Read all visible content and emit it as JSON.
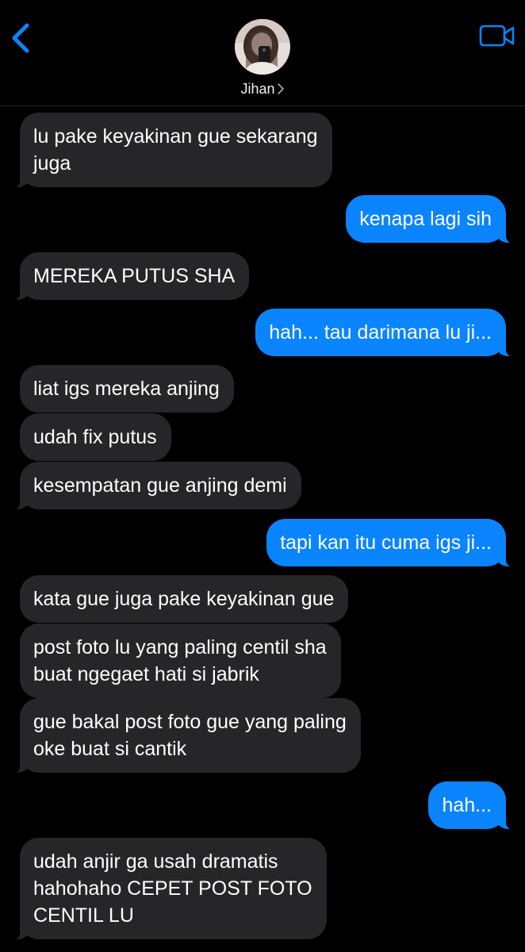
{
  "contact": {
    "name": "Jihan"
  },
  "messages": [
    {
      "dir": "in",
      "lines": [
        "lu pake keyakinan gue sekarang",
        "juga"
      ]
    },
    {
      "dir": "out",
      "lines": [
        "kenapa lagi sih"
      ]
    },
    {
      "dir": "in",
      "lines": [
        "MEREKA PUTUS SHA"
      ]
    },
    {
      "dir": "out",
      "lines": [
        "hah... tau darimana lu ji..."
      ]
    },
    {
      "dir": "in",
      "lines": [
        "liat igs mereka anjing"
      ]
    },
    {
      "dir": "in",
      "lines": [
        "udah fix putus"
      ]
    },
    {
      "dir": "in",
      "lines": [
        "kesempatan gue anjing demi"
      ]
    },
    {
      "dir": "out",
      "lines": [
        "tapi kan itu cuma igs ji..."
      ]
    },
    {
      "dir": "in",
      "lines": [
        "kata gue juga pake keyakinan gue"
      ]
    },
    {
      "dir": "in",
      "lines": [
        "post foto lu yang paling centil sha",
        "buat ngegaet hati si jabrik"
      ]
    },
    {
      "dir": "in",
      "lines": [
        "gue bakal post foto gue yang paling",
        "oke buat si cantik"
      ]
    },
    {
      "dir": "out",
      "lines": [
        "hah..."
      ]
    },
    {
      "dir": "in",
      "lines": [
        "udah anjir ga usah dramatis",
        "hahohaho CEPET POST FOTO",
        "CENTIL LU"
      ]
    }
  ]
}
